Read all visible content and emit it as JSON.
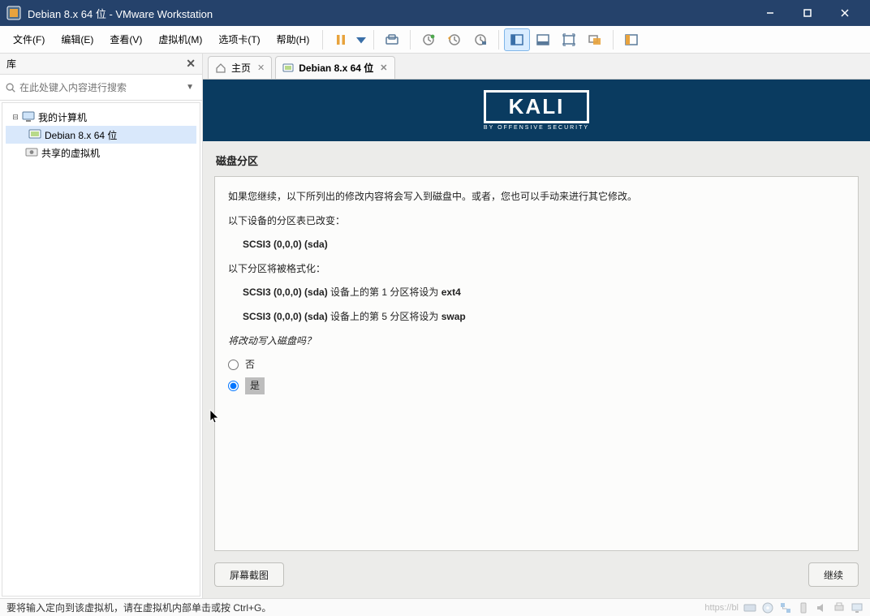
{
  "window": {
    "title": "Debian 8.x 64 位 - VMware Workstation"
  },
  "menu": {
    "file": "文件(F)",
    "edit": "编辑(E)",
    "view": "查看(V)",
    "vm": "虚拟机(M)",
    "tabs": "选项卡(T)",
    "help": "帮助(H)"
  },
  "sidebar": {
    "header": "库",
    "search_placeholder": "在此处键入内容进行搜索",
    "root": "我的计算机",
    "vm": "Debian 8.x 64 位",
    "shared": "共享的虚拟机"
  },
  "tabs": {
    "home": "主页",
    "vm": "Debian 8.x 64 位"
  },
  "kali": {
    "title": "KALI",
    "subtitle": "BY OFFENSIVE SECURITY"
  },
  "installer": {
    "section_title": "磁盘分区",
    "intro": "如果您继续，以下所列出的修改内容将会写入到磁盘中。或者，您也可以手动来进行其它修改。",
    "changed_label": "以下设备的分区表已改变：",
    "changed_item": "SCSI3 (0,0,0) (sda)",
    "format_label": "以下分区将被格式化：",
    "format_item1_prefix": "SCSI3 (0,0,0) (sda)",
    "format_item1_mid": " 设备上的第 1 分区将设为 ",
    "format_item1_fs": "ext4",
    "format_item2_prefix": "SCSI3 (0,0,0) (sda)",
    "format_item2_mid": " 设备上的第 5 分区将设为 ",
    "format_item2_fs": "swap",
    "question": "将改动写入磁盘吗？",
    "option_no": "否",
    "option_yes": "是",
    "btn_screenshot": "屏幕截图",
    "btn_continue": "继续"
  },
  "status": {
    "text": "要将输入定向到该虚拟机，请在虚拟机内部单击或按 Ctrl+G。",
    "watermark": "https://bl"
  }
}
